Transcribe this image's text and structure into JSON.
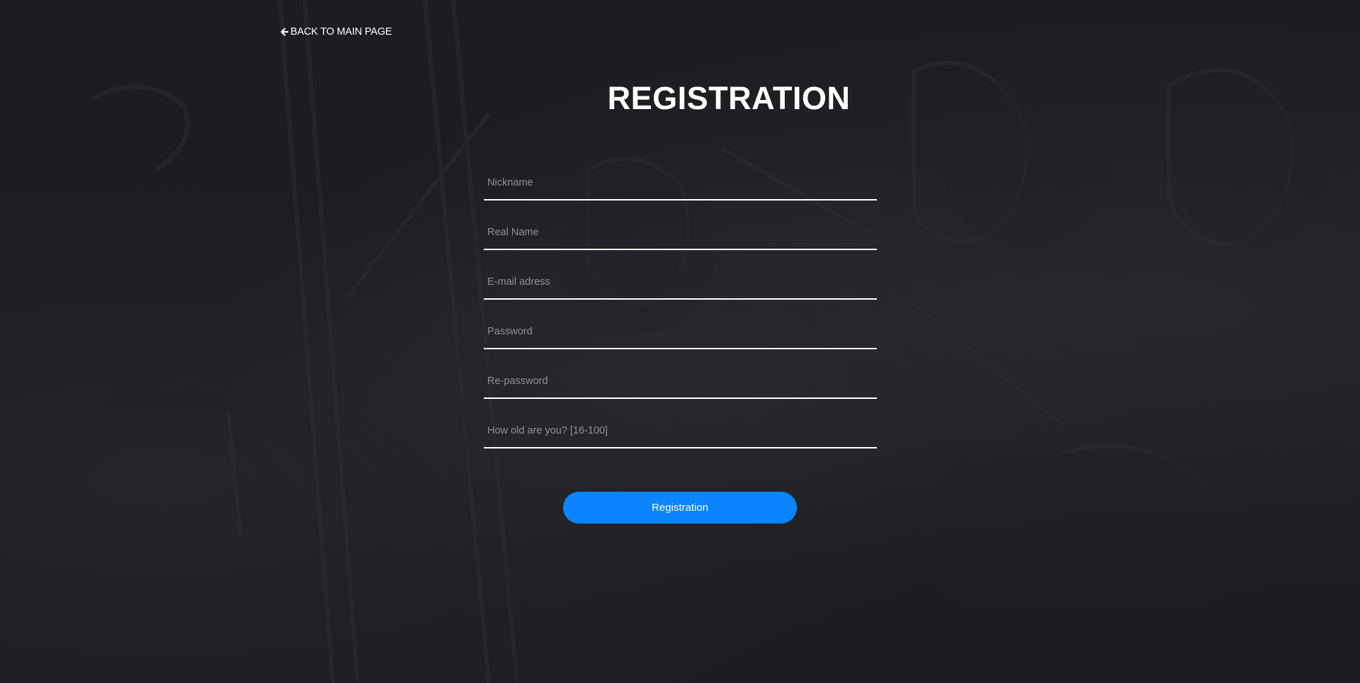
{
  "nav": {
    "back_label": "BACK TO MAIN PAGE",
    "back_icon": "arrow-left-icon"
  },
  "page": {
    "title": "REGISTRATION"
  },
  "form": {
    "fields": [
      {
        "name": "nickname",
        "value": "",
        "placeholder": "Nickname"
      },
      {
        "name": "real-name",
        "value": "",
        "placeholder": "Real Name"
      },
      {
        "name": "email",
        "value": "",
        "placeholder": "E-mail adress"
      },
      {
        "name": "password",
        "value": "",
        "placeholder": "Password"
      },
      {
        "name": "re-password",
        "value": "",
        "placeholder": "Re-password"
      },
      {
        "name": "age",
        "value": "",
        "placeholder": "How old are you? [16-100]"
      }
    ],
    "submit_label": "Registration"
  },
  "colors": {
    "background": "#1b1d21",
    "accent": "#0a84ff",
    "text": "#ffffff",
    "placeholder": "#8e9094"
  }
}
